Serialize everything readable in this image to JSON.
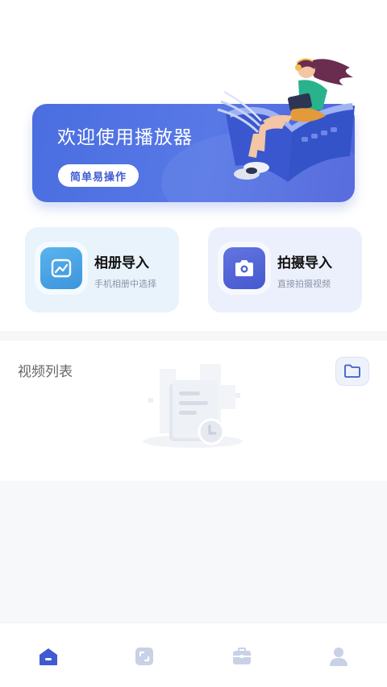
{
  "banner": {
    "title": "欢迎使用播放器",
    "button_label": "简单易操作"
  },
  "cards": [
    {
      "title": "相册导入",
      "subtitle": "手机相册中选择",
      "icon": "image-icon"
    },
    {
      "title": "拍摄导入",
      "subtitle": "直接拍摄视频",
      "icon": "camera-icon"
    }
  ],
  "video_list": {
    "title": "视频列表",
    "folder_icon": "folder-icon",
    "empty_icon": "empty-document-illustration"
  },
  "bottom_nav": {
    "items": [
      {
        "icon": "home-icon",
        "active": true
      },
      {
        "icon": "convert-icon",
        "active": false
      },
      {
        "icon": "toolbox-icon",
        "active": false
      },
      {
        "icon": "profile-icon",
        "active": false
      }
    ]
  },
  "colors": {
    "primary": "#4a6ee0",
    "album_card_bg": "#e8f3fc",
    "shoot_card_bg": "#ecf0fc",
    "nav_active": "#3e5bd2",
    "nav_inactive": "#c9d1e6"
  }
}
